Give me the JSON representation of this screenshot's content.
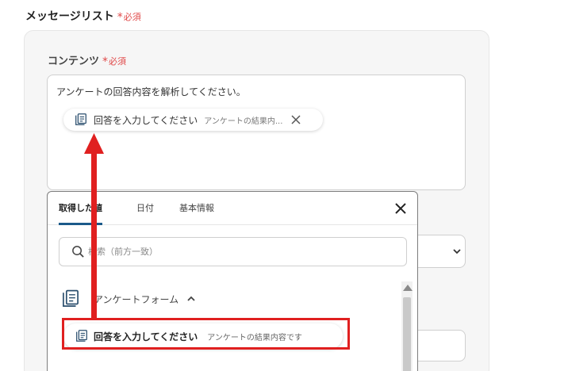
{
  "section": {
    "title": "メッセージリスト",
    "required": "必須"
  },
  "field": {
    "label": "コンテンツ",
    "required": "必須",
    "text": "アンケートの回答内容を解析してください。",
    "chip": {
      "label": "回答を入力してください",
      "sub": "アンケートの結果内...",
      "icon": "document-icon"
    }
  },
  "popup": {
    "tabs": [
      {
        "label": "取得した値",
        "active": true
      },
      {
        "label": "日付",
        "active": false
      },
      {
        "label": "基本情報",
        "active": false
      }
    ],
    "search": {
      "placeholder": "検索（前方一致）",
      "value": ""
    },
    "group": {
      "label": "アンケートフォーム",
      "expanded": true
    },
    "item": {
      "label": "回答を入力してください",
      "sub": "アンケートの結果内容です"
    }
  },
  "colors": {
    "required": "#e04848",
    "tab_underline": "#1b5a8a",
    "highlight": "#e02020"
  }
}
